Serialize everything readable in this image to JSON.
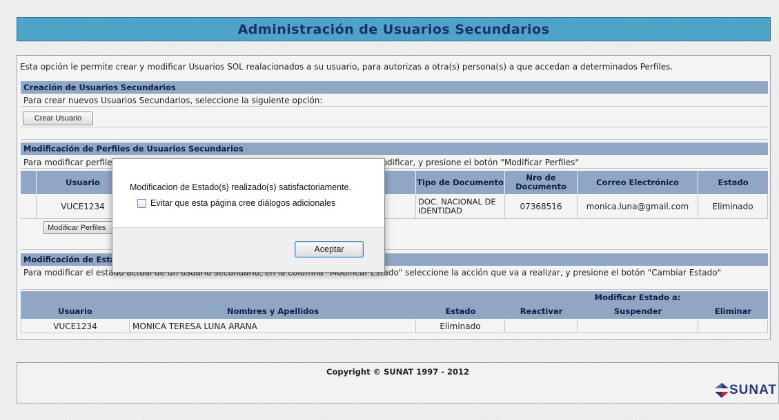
{
  "header": {
    "title": "Administración de Usuarios Secundarios"
  },
  "intro": "Esta opción le permite crear y modificar Usuarios SOL realacionados a su usuario, para autorizas a otra(s) persona(s) a que accedan a determinados Perfiles.",
  "creation": {
    "heading": "Creación de Usuarios Secundarios",
    "instruction": "Para crear nuevos Usuarios Secundarios, seleccione la siguiente opción:",
    "button": "Crear Usuario"
  },
  "profiles": {
    "heading": "Modificación de Perfiles de Usuarios Secundarios",
    "instruction": "Para modificar perfiles ya asignados a usuarios secundarios, seleccione el usuario a modificar, y presione el botón \"Modificar Perfiles\"",
    "columns": {
      "usuario": "Usuario",
      "tipo_doc": "Tipo de Documento",
      "nro_doc": "Nro de Documento",
      "correo": "Correo Electrónico",
      "estado": "Estado"
    },
    "row": {
      "usuario": "VUCE1234",
      "tipo_doc": "DOC. NACIONAL DE IDENTIDAD",
      "nro_doc": "07368516",
      "correo": "monica.luna@gmail.com",
      "estado": "Eliminado"
    },
    "button": "Modificar Perfiles"
  },
  "status": {
    "heading": "Modificación de Estado de Usuarios Secundarios",
    "instruction": "Para modificar el estado actual de un usuario secundario, en la columna \"Modificar Estado\" seleccione la acción que va a realizar, y presione el botón \"Cambiar Estado\"",
    "columns": {
      "group": "Modificar Estado a:",
      "usuario": "Usuario",
      "nombres": "Nombres y Apellidos",
      "estado": "Estado",
      "reactivar": "Reactivar",
      "suspender": "Suspender",
      "eliminar": "Eliminar"
    },
    "row": {
      "usuario": "VUCE1234",
      "nombres": "MONICA TERESA  LUNA ARANA",
      "estado": "Eliminado"
    }
  },
  "footer": {
    "copyright": "Copyright © SUNAT 1997 - 2012",
    "logo": "SUNAT"
  },
  "dialog": {
    "message": "Modificacion de Estado(s) realizado(s) satisfactoriamente.",
    "checkbox_label": "Evitar que esta página cree diálogos adicionales",
    "button": "Aceptar"
  }
}
